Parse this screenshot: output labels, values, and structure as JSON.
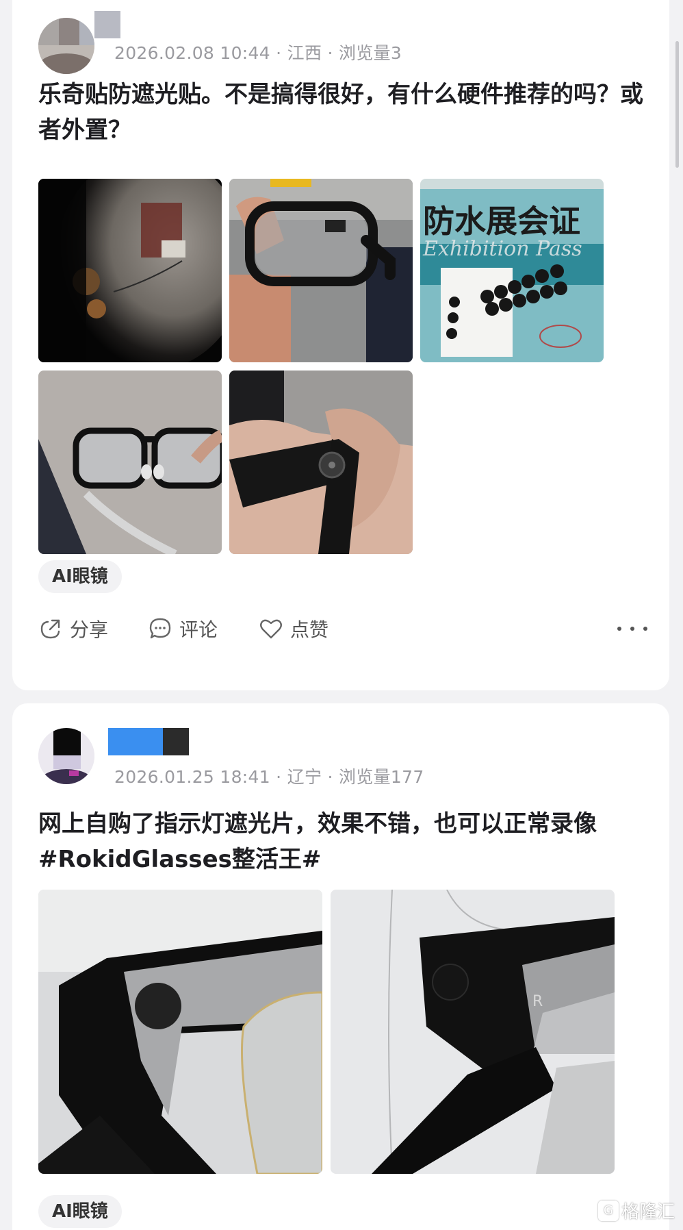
{
  "posts": [
    {
      "meta": "2026.02.08 10:44 · 江西 · 浏览量3",
      "text": "乐奇贴防遮光贴。不是搞得很好，有什么硬件推荐的吗？或者外置？",
      "photos": [
        {
          "icon": "dark-warehouse-photo"
        },
        {
          "icon": "glasses-in-hand-photo"
        },
        {
          "icon": "stickers-on-pass-photo",
          "label_main": "防水展会证",
          "label_sub": "Exhibition Pass"
        },
        {
          "icon": "glasses-front-photo"
        },
        {
          "icon": "glasses-camera-closeup-photo"
        }
      ],
      "tag": "AI眼镜",
      "actions": {
        "share": "分享",
        "comment": "评论",
        "like": "点赞"
      }
    },
    {
      "meta": "2026.01.25 18:41 · 辽宁 · 浏览量177",
      "text": "网上自购了指示灯遮光片，效果不错，也可以正常录像 #RokidGlasses整活王#",
      "photos": [
        {
          "icon": "frame-with-sticker-photo"
        },
        {
          "icon": "frame-camera-photo",
          "mark": "R"
        }
      ],
      "tag": "AI眼镜"
    }
  ],
  "watermark": "格隆汇",
  "watermark_logo": "G"
}
